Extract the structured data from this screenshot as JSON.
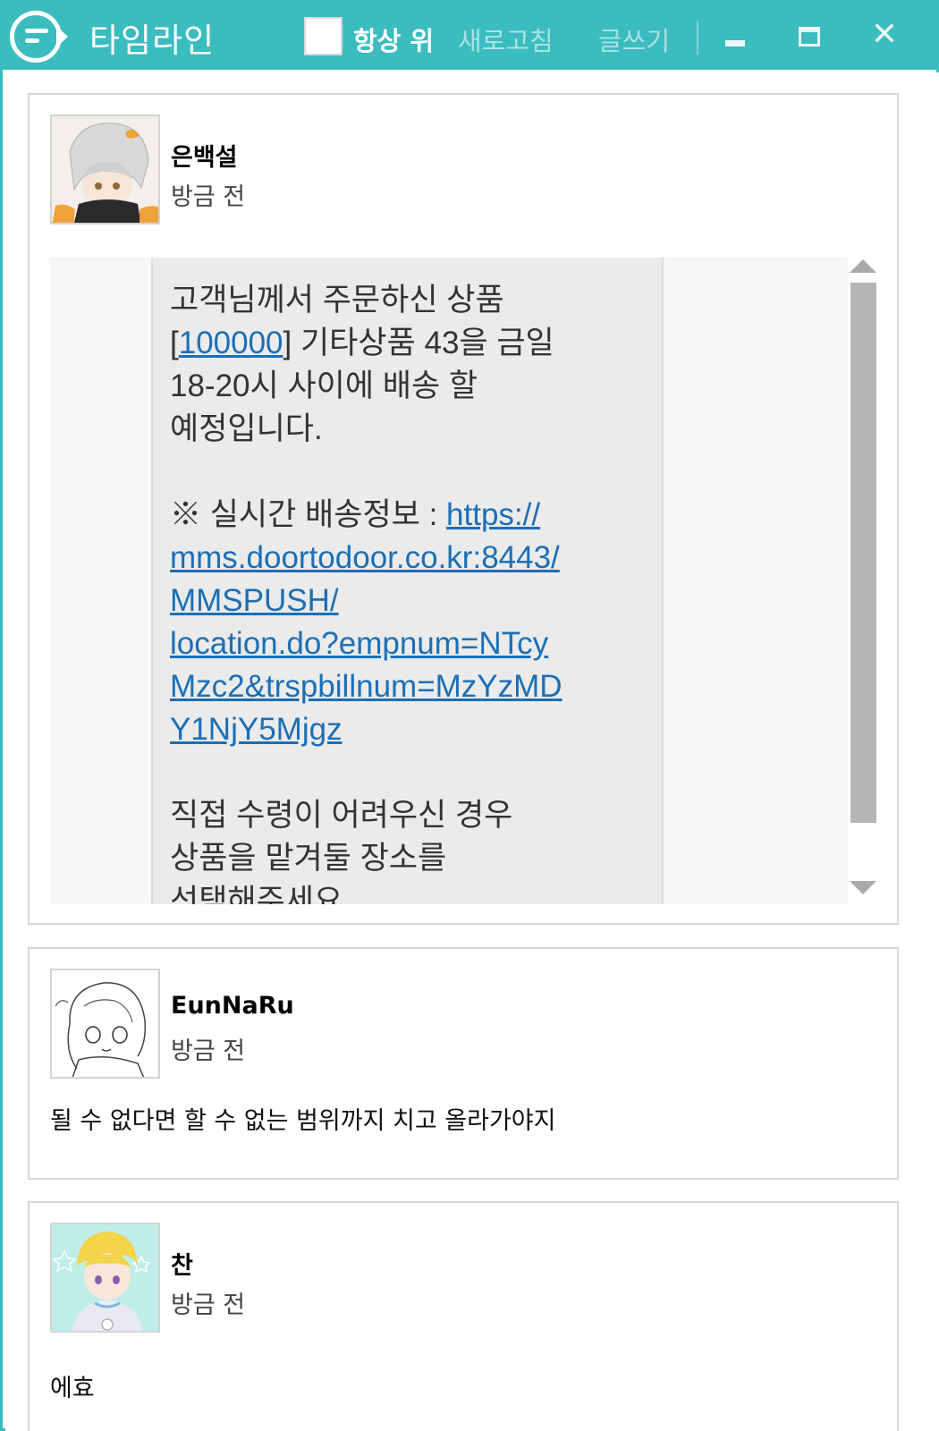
{
  "titlebar": {
    "title": "타임라인",
    "always_on_top_label": "항상 위",
    "always_on_top_checked": false,
    "refresh_label": "새로고침",
    "write_label": "글쓰기",
    "minimize_icon": "minimize-icon",
    "maximize_icon": "maximize-icon",
    "close_icon": "close-icon"
  },
  "colors": {
    "accent": "#3bbcbf",
    "link": "#1b6fb5"
  },
  "posts": [
    {
      "author": "은백설",
      "time": "방금 전",
      "attachment": {
        "type": "image",
        "sms_lines": {
          "l1": "고객님께서 주문하신 상품",
          "l2_prefix": "[",
          "l2_number": "100000",
          "l2_suffix": "] 기타상품 43을 금일",
          "l3": "18-20시 사이에 배송 할",
          "l4": "예정입니다.",
          "l5_label": "※ 실시간 배송정보 : ",
          "link_1": "https://",
          "link_2": "mms.doortodoor.co.kr:8443/",
          "link_3": "MMSPUSH/",
          "link_4": "location.do?empnum=NTcy",
          "link_5": "Mzc2&trspbillnum=MzYzMD",
          "link_6": "Y1NjY5Mjgz",
          "l6": "직접 수령이 어려우신 경우",
          "l7": "상품을 맡겨둘 장소를",
          "l8": "선택해주세요"
        }
      }
    },
    {
      "author": "EunNaRu",
      "time": "방금 전",
      "text": "될 수 없다면 할 수 없는 범위까지 치고 올라가야지"
    },
    {
      "author": "찬",
      "time": "방금 전",
      "text": "에효"
    }
  ]
}
